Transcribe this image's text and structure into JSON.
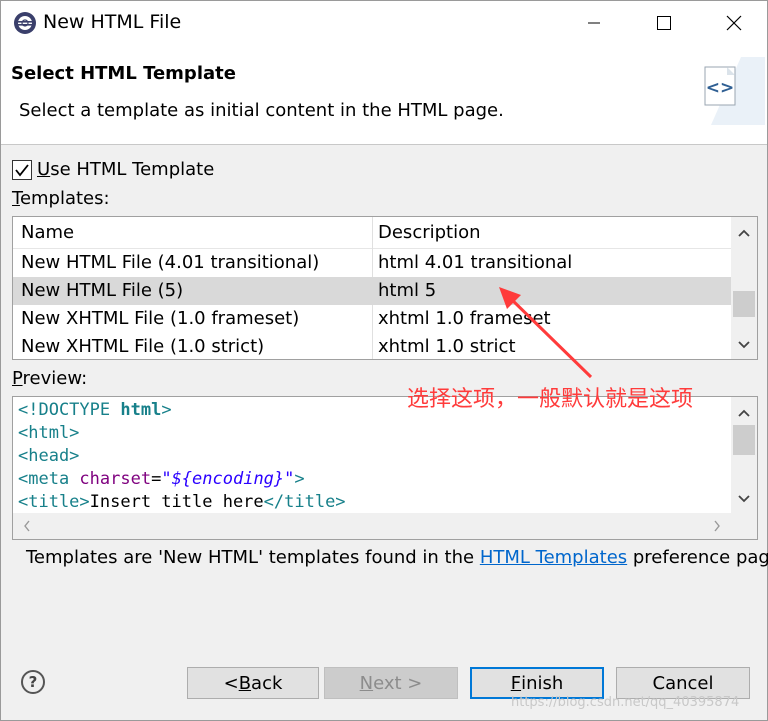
{
  "window": {
    "title": "New HTML File"
  },
  "header": {
    "title": "Select HTML Template",
    "description": "Select a template as initial content in the HTML page."
  },
  "use_template": {
    "checked": true,
    "label_mnemonic": "U",
    "label_rest": "se HTML Template"
  },
  "templates": {
    "label_mnemonic": "T",
    "label_rest": "emplates:",
    "columns": [
      "Name",
      "Description"
    ],
    "rows": [
      {
        "name": "New HTML File (4.01 transitional)",
        "description": "html 4.01 transitional",
        "selected": false
      },
      {
        "name": "New HTML File (5)",
        "description": "html 5",
        "selected": true
      },
      {
        "name": "New XHTML File (1.0 frameset)",
        "description": "xhtml 1.0 frameset",
        "selected": false
      },
      {
        "name": "New XHTML File (1.0 strict)",
        "description": "xhtml 1.0 strict",
        "selected": false
      }
    ]
  },
  "preview": {
    "label_mnemonic": "P",
    "label_rest": "review:",
    "lines": {
      "doctype_tag": "<!DOCTYPE",
      "doctype_name": " html",
      "doctype_end": ">",
      "html_open": "<html>",
      "head_open": "<head>",
      "meta_tag": "<meta",
      "meta_attr": " charset",
      "meta_eq": "=",
      "meta_value": "\"${encoding}\"",
      "meta_end": ">",
      "title_open": "<title>",
      "title_text": "Insert title here",
      "title_close": "</title>"
    }
  },
  "info": {
    "before": "Templates are 'New HTML' templates found in the ",
    "link": "HTML Templates",
    "after": " preference page."
  },
  "annotation": {
    "text": "选择这项，一般默认就是这项",
    "color": "#ff3b3b"
  },
  "buttons": {
    "help": "?",
    "back": {
      "mnemonic": "B",
      "prefix": "< ",
      "rest": "ack"
    },
    "next": {
      "mnemonic": "N",
      "rest": "ext >"
    },
    "finish": {
      "mnemonic": "F",
      "rest": "inish"
    },
    "cancel": "Cancel"
  },
  "watermark": "https://blog.csdn.net/qq_40395874"
}
